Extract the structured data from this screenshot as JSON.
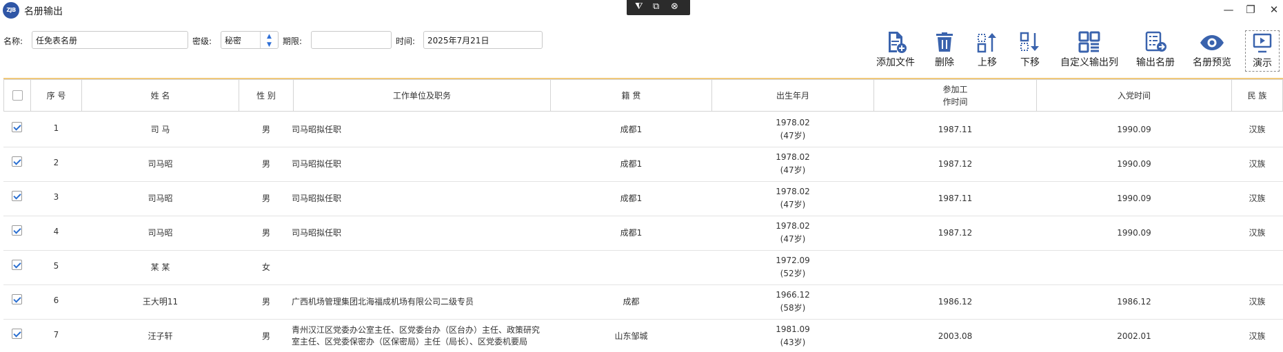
{
  "window": {
    "logo_text": "ZJB",
    "title": "名册输出",
    "float_toolbar": [
      "⧨",
      "⧉",
      "⊗"
    ],
    "controls": [
      "—",
      "❐",
      "✕"
    ]
  },
  "form": {
    "name_label": "名称:",
    "name_value": "任免表名册",
    "secret_label": "密级:",
    "secret_value": "秘密",
    "period_label": "期限:",
    "period_value": "",
    "time_label": "时间:",
    "time_value": "2025年7月21日"
  },
  "toolbar": [
    {
      "label": "添加文件",
      "icon": "add-file-icon"
    },
    {
      "label": "删除",
      "icon": "trash-icon"
    },
    {
      "label": "上移",
      "icon": "move-up-icon"
    },
    {
      "label": "下移",
      "icon": "move-down-icon"
    },
    {
      "label": "自定义输出列",
      "icon": "grid-columns-icon"
    },
    {
      "label": "输出名册",
      "icon": "export-list-icon"
    },
    {
      "label": "名册预览",
      "icon": "eye-icon"
    },
    {
      "label": "演示",
      "icon": "presentation-icon"
    }
  ],
  "accent_color": "#3a63ad",
  "table": {
    "headers": [
      "序 号",
      "姓 名",
      "性 别",
      "工作单位及职务",
      "籍 贯",
      "出生年月",
      "参加工\n作时间",
      "入党时间",
      "民 族"
    ],
    "rows": [
      {
        "checked": true,
        "seq": "1",
        "name": "司 马",
        "gender": "男",
        "unit": "司马昭拟任职",
        "native": "成都1",
        "birth": "1978.02",
        "age": "(47岁)",
        "work": "1987.11",
        "party": "1990.09",
        "ethnic": "汉族"
      },
      {
        "checked": true,
        "seq": "2",
        "name": "司马昭",
        "gender": "男",
        "unit": "司马昭拟任职",
        "native": "成都1",
        "birth": "1978.02",
        "age": "(47岁)",
        "work": "1987.12",
        "party": "1990.09",
        "ethnic": "汉族"
      },
      {
        "checked": true,
        "seq": "3",
        "name": "司马昭",
        "gender": "男",
        "unit": "司马昭拟任职",
        "native": "成都1",
        "birth": "1978.02",
        "age": "(47岁)",
        "work": "1987.11",
        "party": "1990.09",
        "ethnic": "汉族"
      },
      {
        "checked": true,
        "seq": "4",
        "name": "司马昭",
        "gender": "男",
        "unit": "司马昭拟任职",
        "native": "成都1",
        "birth": "1978.02",
        "age": "(47岁)",
        "work": "1987.12",
        "party": "1990.09",
        "ethnic": "汉族"
      },
      {
        "checked": true,
        "seq": "5",
        "name": "某 某",
        "gender": "女",
        "unit": "",
        "native": "",
        "birth": "1972.09",
        "age": "(52岁)",
        "work": "",
        "party": "",
        "ethnic": ""
      },
      {
        "checked": true,
        "seq": "6",
        "name": "王大明11",
        "gender": "男",
        "unit": "广西机场管理集团北海福成机场有限公司二级专员",
        "native": "成都",
        "birth": "1966.12",
        "age": "(58岁)",
        "work": "1986.12",
        "party": "1986.12",
        "ethnic": "汉族"
      },
      {
        "checked": true,
        "seq": "7",
        "name": "汪子轩",
        "gender": "男",
        "unit": "青州汉江区党委办公室主任、区党委台办（区台办）主任、政策研究室主任、区党委保密办（区保密局）主任（局长）、区党委机要局",
        "native": "山东邹城",
        "birth": "1981.09",
        "age": "(43岁)",
        "work": "2003.08",
        "party": "2002.01",
        "ethnic": "汉族"
      }
    ]
  }
}
